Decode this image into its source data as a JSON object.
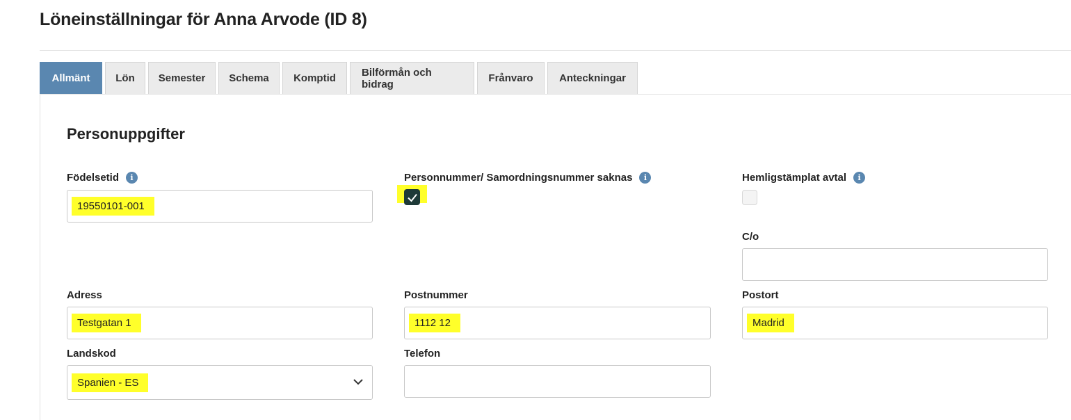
{
  "page": {
    "title": "Löneinställningar för Anna Arvode (ID 8)"
  },
  "tabs": [
    {
      "label": "Allmänt",
      "active": true
    },
    {
      "label": "Lön"
    },
    {
      "label": "Semester"
    },
    {
      "label": "Schema"
    },
    {
      "label": "Komptid"
    },
    {
      "label": "Bilförmån och bidrag"
    },
    {
      "label": "Frånvaro"
    },
    {
      "label": "Anteckningar"
    }
  ],
  "section": {
    "title": "Personuppgifter"
  },
  "form": {
    "birth": {
      "label": "Födelsetid",
      "value": "19550101-001",
      "icon": "info-icon"
    },
    "missing_id": {
      "label": "Personnummer/ Samordningsnummer saknas",
      "checked": true,
      "icon": "info-icon"
    },
    "secret": {
      "label": "Hemligstämplat avtal",
      "checked": false,
      "icon": "info-icon"
    },
    "co": {
      "label": "C/o",
      "value": ""
    },
    "address": {
      "label": "Adress",
      "value": "Testgatan 1"
    },
    "postal_code": {
      "label": "Postnummer",
      "value": "1112 12"
    },
    "city": {
      "label": "Postort",
      "value": "Madrid"
    },
    "country_code": {
      "label": "Landskod",
      "value": "Spanien - ES",
      "icon": "chevron-down-icon"
    },
    "phone": {
      "label": "Telefon",
      "value": ""
    }
  },
  "colors": {
    "accent": "#5a87b0",
    "highlight": "#ffff2a",
    "checkbox": "#1e3a38"
  }
}
